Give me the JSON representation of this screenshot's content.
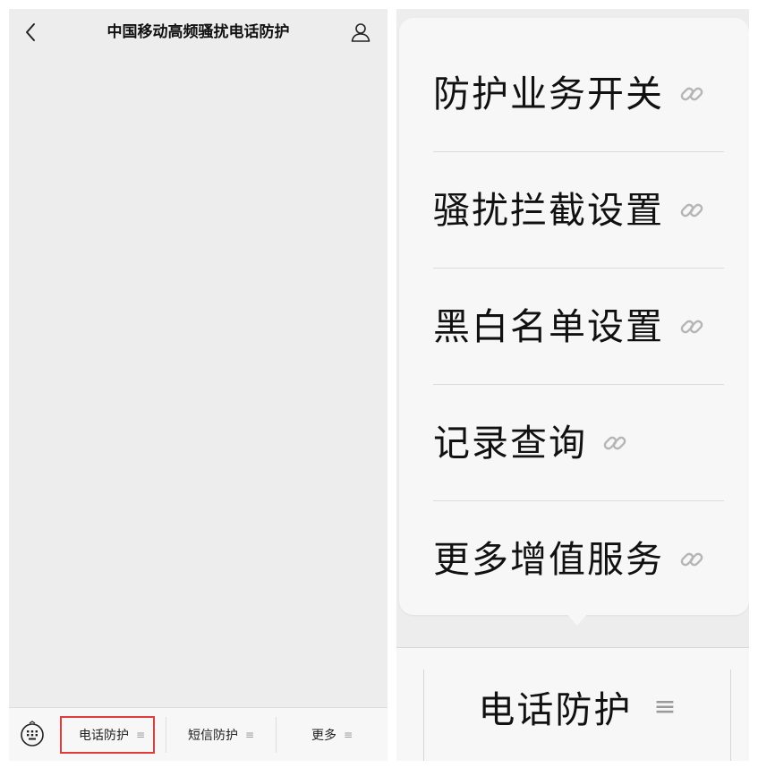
{
  "nav": {
    "title": "中国移动高频骚扰电话防护",
    "back_icon": "chevron-left-icon",
    "profile_icon": "user-icon"
  },
  "bottom_menu": {
    "keyboard_icon": "keyboard-icon",
    "items": [
      {
        "label": "电话防护",
        "lines": "≡"
      },
      {
        "label": "短信防护",
        "lines": "≡"
      },
      {
        "label": "更多",
        "lines": "≡"
      }
    ],
    "highlight_color": "#e23a3a"
  },
  "popup": {
    "items": [
      {
        "label": "防护业务开关",
        "icon": "link-icon"
      },
      {
        "label": "骚扰拦截设置",
        "icon": "link-icon"
      },
      {
        "label": "黑白名单设置",
        "icon": "link-icon"
      },
      {
        "label": "记录查询",
        "icon": "link-icon"
      },
      {
        "label": "更多增值服务",
        "icon": "link-icon"
      }
    ]
  },
  "zoom_menu": {
    "label": "电话防护",
    "lines": "≡"
  }
}
